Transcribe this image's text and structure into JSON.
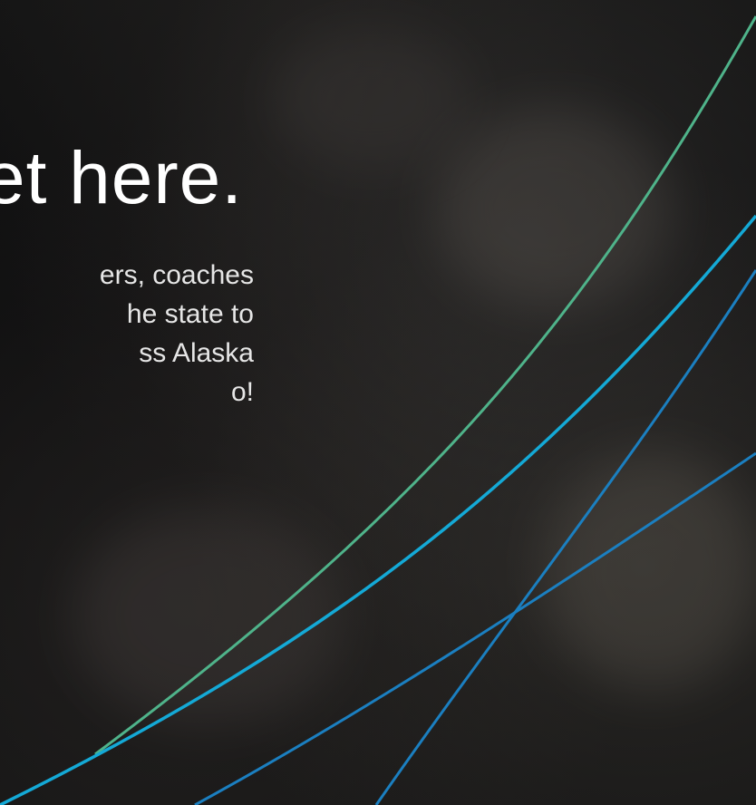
{
  "hero": {
    "headline": "et here.",
    "body_lines": [
      "ers, coaches",
      "he state to",
      "ss Alaska",
      "o!"
    ]
  },
  "colors": {
    "background": "#0b0b0c",
    "text": "#ffffff",
    "curve_green": "#4fb38a",
    "curve_cyan": "#14a9d6",
    "curve_blue": "#1b7fc0"
  },
  "decorations": {
    "background": "blurred-crowd-photo",
    "curves": [
      "curve-green",
      "curve-cyan",
      "curve-blue-steep",
      "curve-blue-shallow"
    ]
  }
}
